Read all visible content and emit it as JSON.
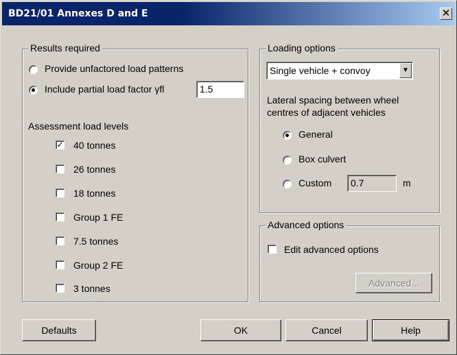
{
  "window": {
    "title": "BD21/01 Annexes D and E",
    "close_glyph": "✕"
  },
  "results": {
    "legend": "Results required",
    "opt_unfactored": "Provide unfactored load patterns",
    "opt_partial": "Include partial load factor γfl",
    "partial_value": "1.5",
    "levels_label": "Assessment load levels",
    "levels": [
      {
        "label": "40 tonnes",
        "checked": true
      },
      {
        "label": "26 tonnes",
        "checked": false
      },
      {
        "label": "18 tonnes",
        "checked": false
      },
      {
        "label": "Group 1 FE",
        "checked": false
      },
      {
        "label": "7.5 tonnes",
        "checked": false
      },
      {
        "label": "Group 2 FE",
        "checked": false
      },
      {
        "label": "3 tonnes",
        "checked": false
      }
    ]
  },
  "loading": {
    "legend": "Loading options",
    "selected": "Single vehicle + convoy",
    "spacing_line1": "Lateral spacing between wheel",
    "spacing_line2": "centres of adjacent vehicles",
    "opt_general": "General",
    "opt_box": "Box culvert",
    "opt_custom": "Custom",
    "custom_value": "0.7",
    "custom_unit": "m"
  },
  "advanced": {
    "legend": "Advanced options",
    "edit_label": "Edit advanced options",
    "button": "Advanced..."
  },
  "buttons": {
    "defaults": "Defaults",
    "ok": "OK",
    "cancel": "Cancel",
    "help": "Help"
  }
}
